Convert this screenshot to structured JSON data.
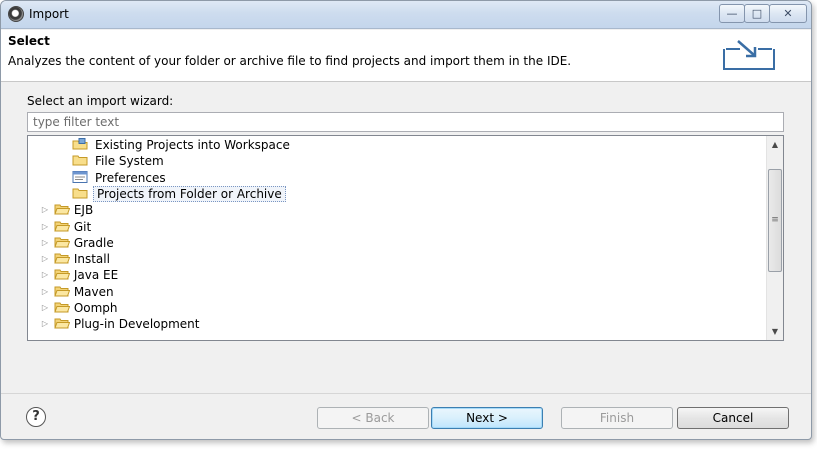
{
  "window": {
    "title": "Import",
    "controls": {
      "minimize": "—",
      "maximize": "□",
      "close": "✕"
    }
  },
  "header": {
    "heading": "Select",
    "description": "Analyzes the content of your folder or archive file to find projects and import them in the IDE."
  },
  "wizard": {
    "label": "Select an import wizard:",
    "filter_placeholder": "type filter text",
    "filter_value": ""
  },
  "tree": {
    "children": [
      {
        "label": "Existing Projects into Workspace",
        "icon": "projects-icon"
      },
      {
        "label": "File System",
        "icon": "folder-icon"
      },
      {
        "label": "Preferences",
        "icon": "preferences-icon"
      },
      {
        "label": "Projects from Folder or Archive",
        "icon": "folder-icon",
        "selected": true
      }
    ],
    "categories": [
      "EJB",
      "Git",
      "Gradle",
      "Install",
      "Java EE",
      "Maven",
      "Oomph",
      "Plug-in Development"
    ]
  },
  "buttons": {
    "back": "< Back",
    "next": "Next >",
    "finish": "Finish",
    "cancel": "Cancel",
    "help": "?"
  },
  "colors": {
    "title_gradient": "#cddcee",
    "selection_border": "#7a96c2",
    "default_button": "#3c7fb1"
  }
}
